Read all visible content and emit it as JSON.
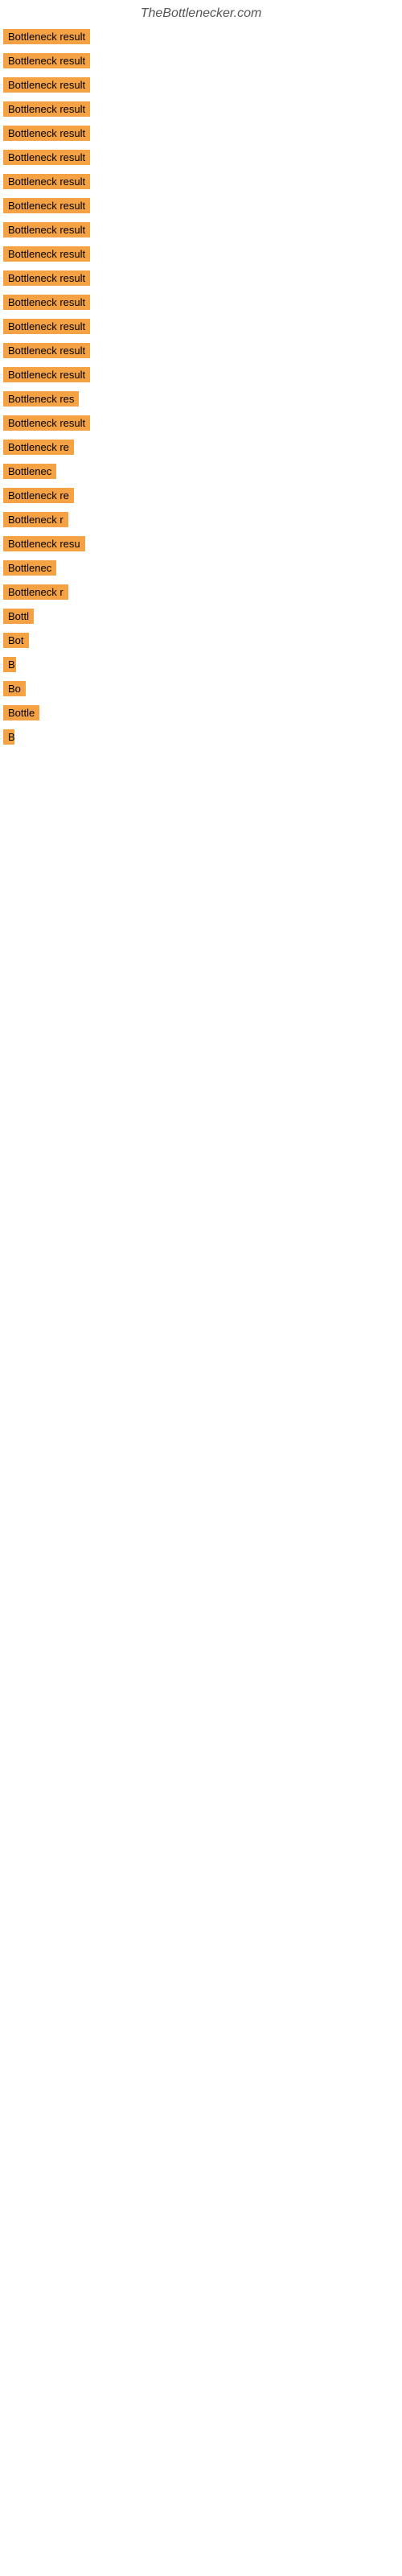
{
  "header": {
    "title": "TheBottlenecker.com"
  },
  "items": [
    {
      "label": "Bottleneck result",
      "width": 155,
      "fontSize": 13
    },
    {
      "label": "Bottleneck result",
      "width": 155,
      "fontSize": 13
    },
    {
      "label": "Bottleneck result",
      "width": 150,
      "fontSize": 13
    },
    {
      "label": "Bottleneck result",
      "width": 145,
      "fontSize": 13
    },
    {
      "label": "Bottleneck result",
      "width": 150,
      "fontSize": 13
    },
    {
      "label": "Bottleneck result",
      "width": 148,
      "fontSize": 13
    },
    {
      "label": "Bottleneck result",
      "width": 145,
      "fontSize": 13
    },
    {
      "label": "Bottleneck result",
      "width": 143,
      "fontSize": 13
    },
    {
      "label": "Bottleneck result",
      "width": 140,
      "fontSize": 13
    },
    {
      "label": "Bottleneck result",
      "width": 138,
      "fontSize": 13
    },
    {
      "label": "Bottleneck result",
      "width": 135,
      "fontSize": 13
    },
    {
      "label": "Bottleneck result",
      "width": 132,
      "fontSize": 13
    },
    {
      "label": "Bottleneck result",
      "width": 130,
      "fontSize": 13
    },
    {
      "label": "Bottleneck result",
      "width": 128,
      "fontSize": 13
    },
    {
      "label": "Bottleneck result",
      "width": 126,
      "fontSize": 13
    },
    {
      "label": "Bottleneck res",
      "width": 112,
      "fontSize": 13
    },
    {
      "label": "Bottleneck result",
      "width": 120,
      "fontSize": 13
    },
    {
      "label": "Bottleneck re",
      "width": 108,
      "fontSize": 13
    },
    {
      "label": "Bottlenec",
      "width": 85,
      "fontSize": 13
    },
    {
      "label": "Bottleneck re",
      "width": 106,
      "fontSize": 13
    },
    {
      "label": "Bottleneck r",
      "width": 100,
      "fontSize": 13
    },
    {
      "label": "Bottleneck resu",
      "width": 112,
      "fontSize": 13
    },
    {
      "label": "Bottlenec",
      "width": 82,
      "fontSize": 13
    },
    {
      "label": "Bottleneck r",
      "width": 98,
      "fontSize": 13
    },
    {
      "label": "Bottl",
      "width": 48,
      "fontSize": 13
    },
    {
      "label": "Bot",
      "width": 38,
      "fontSize": 13
    },
    {
      "label": "B",
      "width": 16,
      "fontSize": 13
    },
    {
      "label": "Bo",
      "width": 28,
      "fontSize": 13
    },
    {
      "label": "Bottle",
      "width": 52,
      "fontSize": 13
    },
    {
      "label": "B",
      "width": 14,
      "fontSize": 13
    }
  ]
}
